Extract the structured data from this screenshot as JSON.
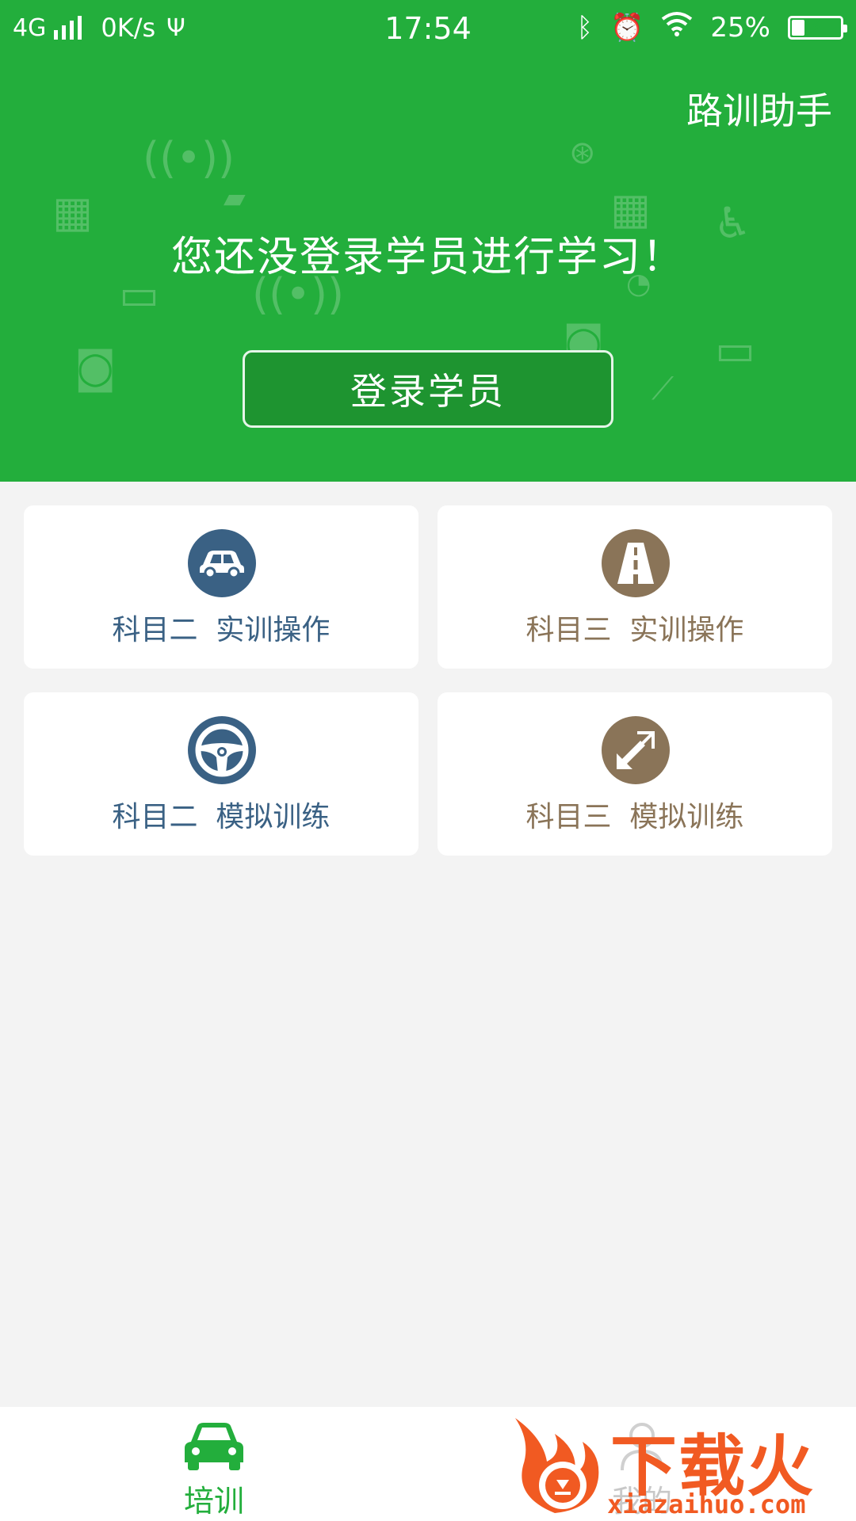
{
  "status_bar": {
    "network": "4G",
    "speed": "0K/s",
    "time": "17:54",
    "battery": "25%",
    "battery_level": 0.25
  },
  "header": {
    "app_title": "路训助手",
    "prompt": "您还没登录学员进行学习！",
    "login_button": "登录学员"
  },
  "cards": [
    {
      "label": "科目二  实训操作",
      "icon": "car-icon",
      "color": "#3a6184"
    },
    {
      "label": "科目三  实训操作",
      "icon": "road-icon",
      "color": "#8a7458"
    },
    {
      "label": "科目二  模拟训练",
      "icon": "steering-wheel-icon",
      "color": "#3a6184"
    },
    {
      "label": "科目三  模拟训练",
      "icon": "expand-arrows-icon",
      "color": "#8a7458"
    }
  ],
  "bottom_nav": {
    "items": [
      {
        "label": "培训",
        "icon": "car-icon",
        "active": true
      },
      {
        "label": "我的",
        "icon": "person-icon",
        "active": false
      }
    ]
  },
  "watermark": {
    "brand": "下载火",
    "url": "xiazaihuo.com"
  },
  "colors": {
    "primary_green": "#23ae3c",
    "button_green": "#1e9430",
    "blue": "#3a6184",
    "brown": "#8a7458",
    "background": "#f3f3f3"
  }
}
